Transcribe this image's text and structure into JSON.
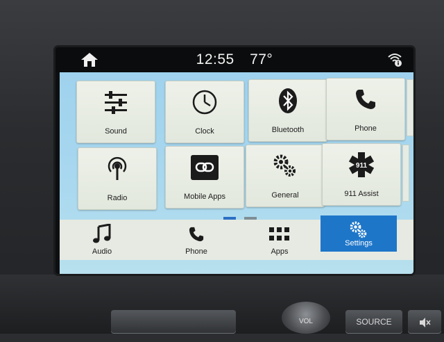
{
  "status": {
    "time": "12:55",
    "temperature": "77°"
  },
  "tiles": [
    {
      "label": "Sound",
      "icon": "sliders-icon"
    },
    {
      "label": "Clock",
      "icon": "clock-icon"
    },
    {
      "label": "Bluetooth",
      "icon": "bluetooth-icon"
    },
    {
      "label": "Phone",
      "icon": "phone-icon"
    },
    {
      "label": "Radio",
      "icon": "radio-icon"
    },
    {
      "label": "Mobile Apps",
      "icon": "link-icon"
    },
    {
      "label": "General",
      "icon": "gears-icon"
    },
    {
      "label": "911 Assist",
      "icon": "star-of-life-icon",
      "badge": "911"
    }
  ],
  "nav": [
    {
      "label": "Audio",
      "icon": "music-note-icon"
    },
    {
      "label": "Phone",
      "icon": "phone-icon"
    },
    {
      "label": "Apps",
      "icon": "grid-icon"
    },
    {
      "label": "Settings",
      "icon": "gears-icon",
      "active": true
    }
  ],
  "hardware": {
    "knob_label": "VOL",
    "source_label": "SOURCE",
    "mute_icon": "mute-icon"
  },
  "colors": {
    "active_nav": "#1e76c9",
    "page_indicator_active": "#2b6fc6",
    "screen_bg": "#a9d8ef"
  }
}
